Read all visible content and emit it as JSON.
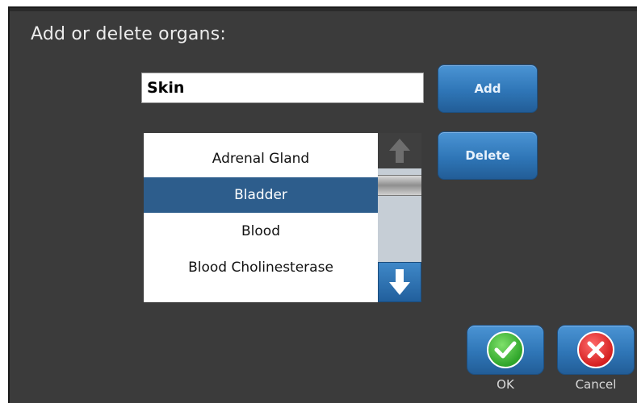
{
  "dialog": {
    "title": "Add or delete organs:",
    "input_value": "Skin",
    "add_label": "Add",
    "delete_label": "Delete"
  },
  "list": {
    "items": [
      "Adrenal Gland",
      "Bladder",
      "Blood",
      "Blood Cholinesterase"
    ],
    "selected": "Bladder"
  },
  "footer": {
    "ok_label": "OK",
    "cancel_label": "Cancel"
  },
  "colors": {
    "background": "#3b3b3b",
    "button_blue": "#2f76b7",
    "selected_row": "#2d5d8c",
    "ok_green": "#2fa52a",
    "cancel_red": "#d42020"
  },
  "icons": [
    "arrow-up-icon",
    "arrow-down-icon",
    "checkmark-icon",
    "x-icon"
  ]
}
